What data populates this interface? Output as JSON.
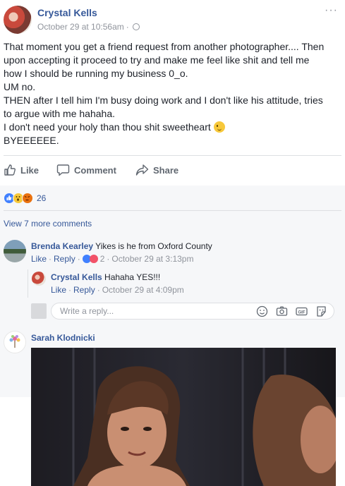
{
  "post": {
    "author": "Crystal Kells",
    "timestamp": "October 29 at 10:56am",
    "separator": "·",
    "menu": "···",
    "body_lines": [
      "That moment you get a friend request from another photographer.... Then",
      "upon accepting it proceed to try and make me feel like shit and tell me",
      "how I should be running my business 0_o.",
      "UM no.",
      "THEN after I tell him I'm busy doing work and I don't like his attitude, tries",
      "to argue with me hahaha.",
      "I don't need your holy than thou shit sweetheart",
      "BYEEEEEE."
    ],
    "emoji_after_line": 6,
    "emoji": "wink-emoji"
  },
  "actions": {
    "like": "Like",
    "comment": "Comment",
    "share": "Share"
  },
  "reactions": {
    "icons": [
      "like-icon",
      "wow-icon",
      "angry-icon"
    ],
    "count": "26"
  },
  "comments": {
    "view_more": "View 7 more comments",
    "items": [
      {
        "author": "Brenda Kearley",
        "text": "Yikes is he from Oxford County",
        "like": "Like",
        "reply": "Reply",
        "reaction_count": "2",
        "time": "October 29 at 3:13pm"
      },
      {
        "author": "Crystal Kells",
        "text": "Hahaha YES!!!",
        "like": "Like",
        "reply": "Reply",
        "time": "October 29 at 4:09pm"
      },
      {
        "author": "Sarah Klodnicki"
      }
    ],
    "dot": "·",
    "reply_placeholder": "Write a reply...",
    "reply_icons": [
      "emoji-icon",
      "camera-icon",
      "gif-icon",
      "sticker-icon"
    ]
  },
  "colors": {
    "link": "#365899",
    "muted": "#90949c",
    "like_blue": "#4080ff",
    "angry_orange": "#e9710f",
    "wow_yellow": "#f7c83a",
    "comment_bg": "#f6f7f9"
  }
}
